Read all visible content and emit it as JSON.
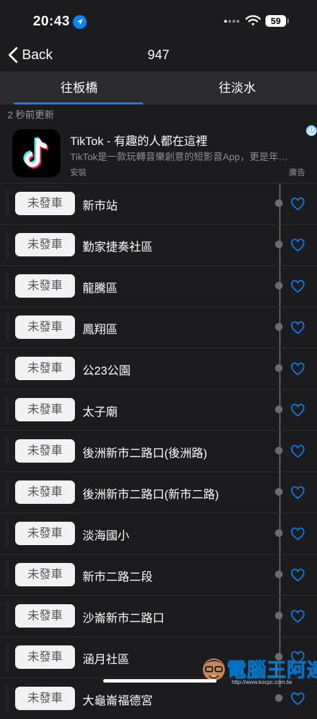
{
  "status_bar": {
    "time": "20:43",
    "battery": "59",
    "icons": [
      "location-arrow-icon",
      "cellular-signal-icon",
      "wifi-icon",
      "battery-icon"
    ]
  },
  "nav": {
    "back_label": "Back",
    "title": "947"
  },
  "tabs": [
    {
      "label": "往板橋",
      "selected": true
    },
    {
      "label": "往淡水",
      "selected": false
    }
  ],
  "updated_text": "2 秒前更新",
  "ad": {
    "title": "TikTok - 有趣的人都在這裡",
    "description": "TikTok是一款玩轉音樂創意的短影音App，更是年…",
    "install_label": "安裝",
    "ad_label": "廣告",
    "info_icon": "ⓘ"
  },
  "stops": [
    {
      "status": "未發車",
      "name": "新市站"
    },
    {
      "status": "未發車",
      "name": "勤家捷奏社區"
    },
    {
      "status": "未發車",
      "name": "龍騰區"
    },
    {
      "status": "未發車",
      "name": "鳳翔區"
    },
    {
      "status": "未發車",
      "name": "公23公園"
    },
    {
      "status": "未發車",
      "name": "太子廟"
    },
    {
      "status": "未發車",
      "name": "後洲新市二路口(後洲路)"
    },
    {
      "status": "未發車",
      "name": "後洲新市二路口(新市二路)"
    },
    {
      "status": "未發車",
      "name": "淡海國小"
    },
    {
      "status": "未發車",
      "name": "新市二路二段"
    },
    {
      "status": "未發車",
      "name": "沙崙新市二路口"
    },
    {
      "status": "未發車",
      "name": "涵月社區"
    },
    {
      "status": "未發車",
      "name": "大龜崙福德宮"
    }
  ],
  "watermark": {
    "text": "電腦王阿達",
    "url": "http://www.kocpc.com.tw"
  },
  "colors": {
    "accent": "#0a84ff",
    "background": "#1c1c1e",
    "tab_bar": "#2c2c2e",
    "badge": "#f2f2f4"
  }
}
